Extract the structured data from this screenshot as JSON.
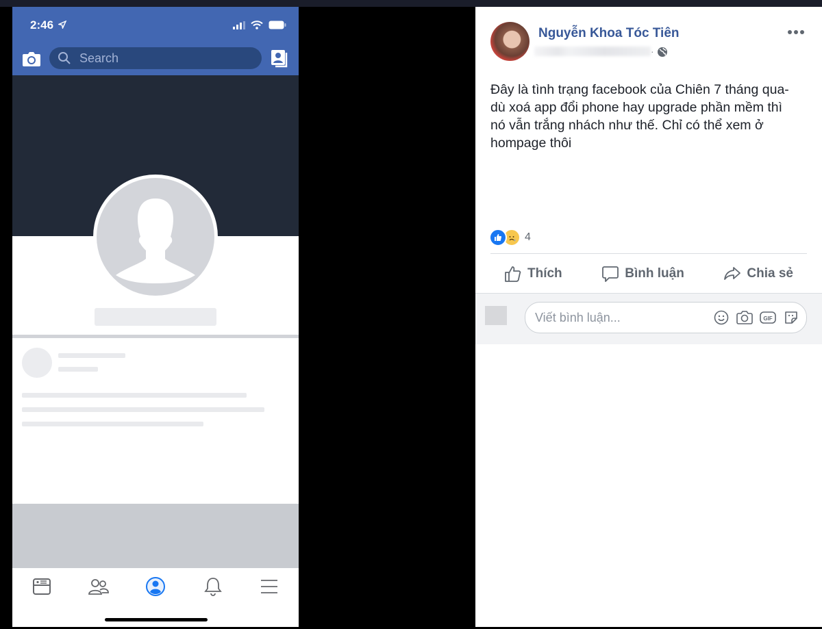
{
  "phone": {
    "status_bar": {
      "time": "2:46",
      "location_icon": "location-arrow-icon",
      "signal_icon": "cellular-signal-icon",
      "wifi_icon": "wifi-icon",
      "battery_icon": "battery-icon"
    },
    "header": {
      "camera_icon": "camera-icon",
      "search": {
        "placeholder": "Search",
        "value": ""
      },
      "contacts_icon": "contacts-icon"
    },
    "tab_bar": {
      "tabs": [
        {
          "name": "news-feed",
          "icon": "news-feed-icon",
          "active": false
        },
        {
          "name": "friends",
          "icon": "friends-icon",
          "active": false
        },
        {
          "name": "profile",
          "icon": "profile-icon",
          "active": true
        },
        {
          "name": "notifications",
          "icon": "bell-icon",
          "active": false
        },
        {
          "name": "menu",
          "icon": "hamburger-menu-icon",
          "active": false
        }
      ]
    },
    "colors": {
      "brand": "#4267b2",
      "cover": "#222a38",
      "active_tab": "#1877f2"
    }
  },
  "post": {
    "author": "Nguyễn Khoa Tóc Tiên",
    "privacy_icon": "globe-icon",
    "text": "Đây là tình trạng facebook của Chiên 7 tháng qua-\ndù xoá app đổi phone hay upgrade phần mềm thì\nnó vẫn trắng nhách như thế. Chỉ có thể xem ở\nhompage thôi",
    "reactions": {
      "types": [
        "like",
        "sad"
      ],
      "count": "4"
    },
    "actions": {
      "like": "Thích",
      "comment": "Bình luận",
      "share": "Chia sẻ"
    },
    "comment_box": {
      "placeholder": "Viết bình luận...",
      "value": "",
      "tools": [
        "emoji-icon",
        "camera-icon",
        "gif-icon",
        "sticker-icon"
      ],
      "gif_label": "GIF"
    },
    "colors": {
      "author_link": "#385898",
      "text": "#1d2129",
      "secondary": "#606770"
    }
  }
}
